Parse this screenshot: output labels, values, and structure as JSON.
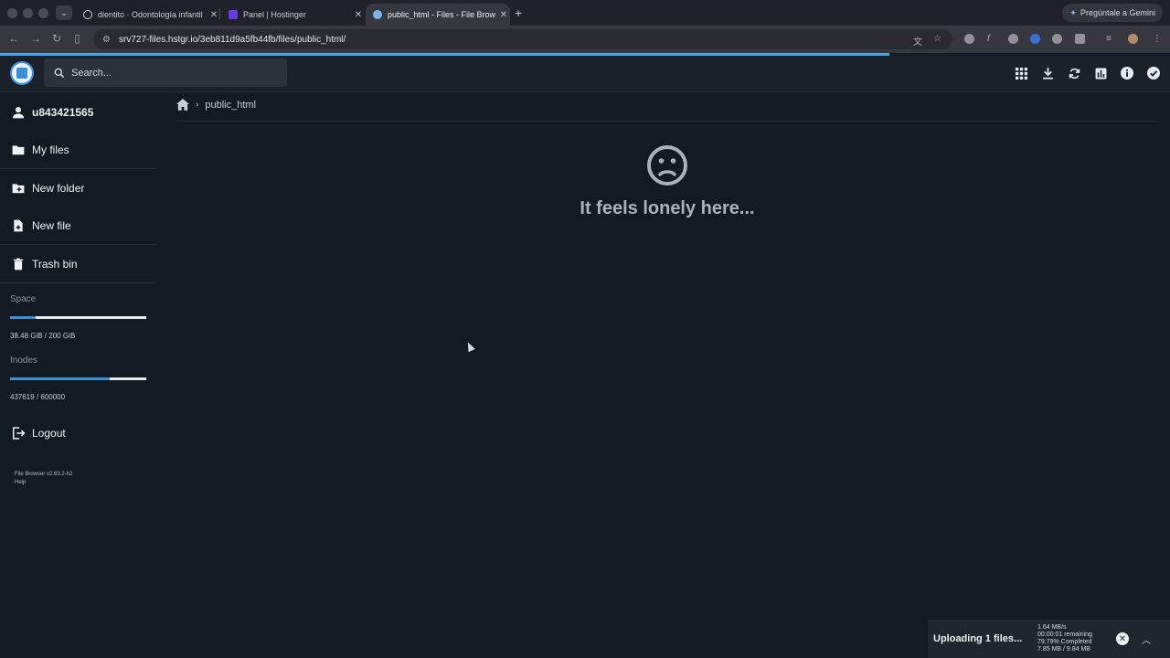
{
  "browser": {
    "tabs": [
      {
        "title": "dientito · Odontología infantil",
        "color": "#9aa0a6"
      },
      {
        "title": "Panel | Hostinger",
        "color": "#673de6"
      },
      {
        "title": "public_html - Files - File Brow",
        "color": "#7fb2e6"
      }
    ],
    "gemini_label": "Pregúntale a Gemini",
    "url": "srv727-files.hstgr.io/3eb811d9a5fb44fb/files/public_html/",
    "load_progress": 0.76
  },
  "header": {
    "search_placeholder": "Search...",
    "accent": "#3a8fd9"
  },
  "sidebar": {
    "user": "u843421565",
    "items": [
      {
        "label": "My files",
        "icon": "folder-icon"
      },
      {
        "label": "New folder",
        "icon": "create-folder-icon"
      },
      {
        "label": "New file",
        "icon": "note-add-icon"
      },
      {
        "label": "Trash bin",
        "icon": "delete-icon"
      }
    ],
    "space": {
      "title": "Space",
      "text": "38.48 GiB / 200 GiB",
      "fraction": 0.19
    },
    "inodes": {
      "title": "Inodes",
      "text": "437619 / 600000",
      "fraction": 0.73
    },
    "logout": "Logout",
    "version": "File Browser v2.63.2-h2",
    "help": "Help"
  },
  "breadcrumb": {
    "current": "public_html"
  },
  "empty_state": {
    "message": "It feels lonely here..."
  },
  "upload": {
    "title": "Uploading 1 files...",
    "speed": "1.64 MB/s",
    "remaining": "00:00:01 remaining",
    "completed": "79.79% Completed",
    "size": "7.85 MB / 9.84 MB"
  }
}
